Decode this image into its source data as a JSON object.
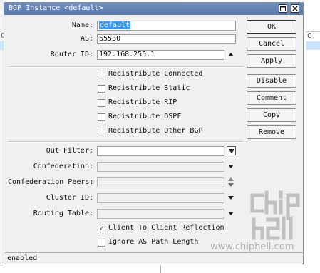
{
  "dialog": {
    "title": "BGP Instance <default>",
    "fields": {
      "name": {
        "label": "Name:",
        "value": "default"
      },
      "as": {
        "label": "AS:",
        "value": "65530"
      },
      "router_id": {
        "label": "Router ID:",
        "value": "192.168.255.1"
      }
    },
    "redistribute": [
      {
        "label": "Redistribute Connected",
        "checked": false
      },
      {
        "label": "Redistribute Static",
        "checked": false
      },
      {
        "label": "Redistribute RIP",
        "checked": false
      },
      {
        "label": "Redistribute OSPF",
        "checked": false
      },
      {
        "label": "Redistribute Other BGP",
        "checked": false
      }
    ],
    "lower_fields": {
      "out_filter": {
        "label": "Out Filter:",
        "value": ""
      },
      "confederation": {
        "label": "Confederation:",
        "value": ""
      },
      "confederation_peers": {
        "label": "Confederation Peers:",
        "value": ""
      },
      "cluster_id": {
        "label": "Cluster ID:",
        "value": ""
      },
      "routing_table": {
        "label": "Routing Table:",
        "value": ""
      }
    },
    "options": [
      {
        "label": "Client To Client Reflection",
        "checked": true
      },
      {
        "label": "Ignore AS Path Length",
        "checked": false
      }
    ],
    "buttons": {
      "ok": "OK",
      "cancel": "Cancel",
      "apply": "Apply",
      "disable": "Disable",
      "comment": "Comment",
      "copy": "Copy",
      "remove": "Remove"
    },
    "status": "enabled",
    "check_glyph": "✓"
  },
  "watermark": {
    "text": "www.chiphell.com"
  },
  "background": {
    "left_glyph": "C",
    "right_glyph": "C"
  },
  "colors": {
    "titlebar": "#5a78a8",
    "selection": "#3399ff",
    "dialog_bg": "#f0f0f0"
  }
}
